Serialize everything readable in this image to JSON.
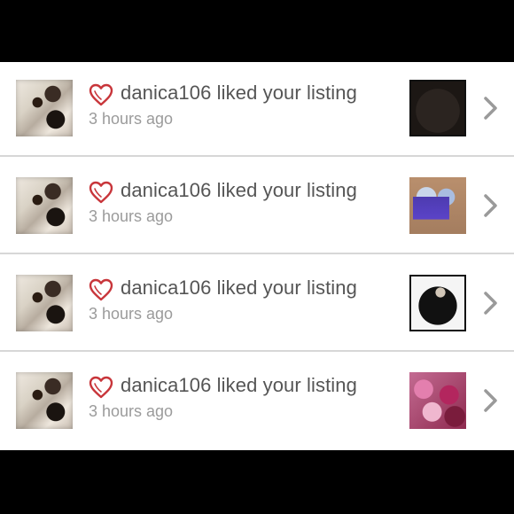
{
  "notifications": [
    {
      "username": "danica106",
      "message": "liked your listing",
      "time": "3 hours ago"
    },
    {
      "username": "danica106",
      "message": "liked your listing",
      "time": "3 hours ago"
    },
    {
      "username": "danica106",
      "message": "liked your listing",
      "time": "3 hours ago"
    },
    {
      "username": "danica106",
      "message": "liked your listing",
      "time": "3 hours ago"
    }
  ],
  "colors": {
    "heart": "#c8353a",
    "title_text": "#555555",
    "time_text": "#9b9b9b",
    "chevron": "#9a9a9a",
    "divider": "#d7d7d7"
  },
  "icons": {
    "like": "heart-icon",
    "navigate": "chevron-right-icon"
  }
}
